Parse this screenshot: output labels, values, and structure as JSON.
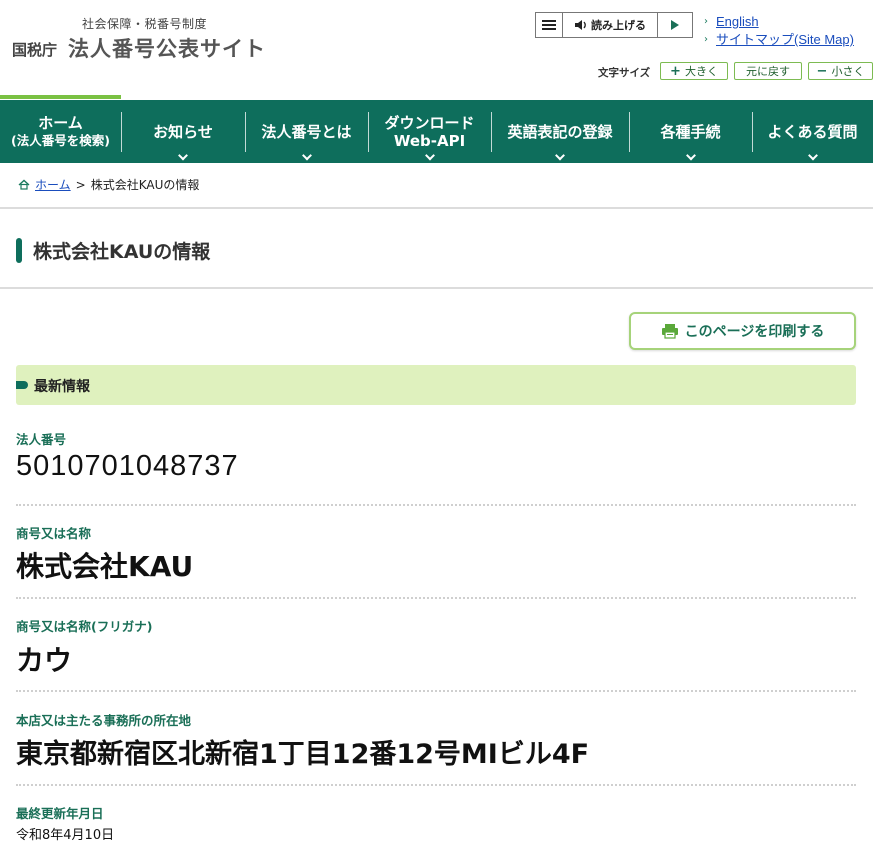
{
  "header": {
    "subtitle": "社会保障・税番号制度",
    "agency": "国税庁",
    "site_name": "法人番号公表サイト",
    "read_aloud": "読み上げる",
    "lang_links": [
      "English",
      "サイトマップ(Site Map)"
    ],
    "font_size_label": "文字サイズ",
    "font_buttons": {
      "large": "大きく",
      "reset": "元に戻す",
      "small": "小さく"
    },
    "icons": {
      "menu": "hamburger-icon",
      "speaker": "speaker-icon",
      "play": "play-icon"
    }
  },
  "nav": {
    "items": [
      {
        "line1": "ホーム",
        "line2": "(法人番号を検索)"
      },
      {
        "line1": "お知らせ"
      },
      {
        "line1": "法人番号とは"
      },
      {
        "line1": "ダウンロード",
        "line2": "Web-API"
      },
      {
        "line1": "英語表記の登録"
      },
      {
        "line1": "各種手続"
      },
      {
        "line1": "よくある質問"
      }
    ]
  },
  "breadcrumb": {
    "home": "ホーム",
    "separator": ">",
    "current": "株式会社KAUの情報"
  },
  "page": {
    "title": "株式会社KAUの情報",
    "print_button": "このページを印刷する",
    "section_title": "最新情報"
  },
  "records": [
    {
      "label": "法人番号",
      "value": "5010701048737"
    },
    {
      "label": "商号又は名称",
      "value": "株式会社KAU"
    },
    {
      "label": "商号又は名称(フリガナ)",
      "value": "カウ"
    },
    {
      "label": "本店又は主たる事務所の所在地",
      "value": "東京都新宿区北新宿1丁目12番12号MIビル4F"
    },
    {
      "label": "最終更新年月日",
      "value": "令和8年4月10日"
    }
  ],
  "colors": {
    "brand_green": "#0e6e5c",
    "accent_lime": "#7ac142",
    "section_bg": "#dff1be",
    "link_blue": "#1a4dbd"
  }
}
